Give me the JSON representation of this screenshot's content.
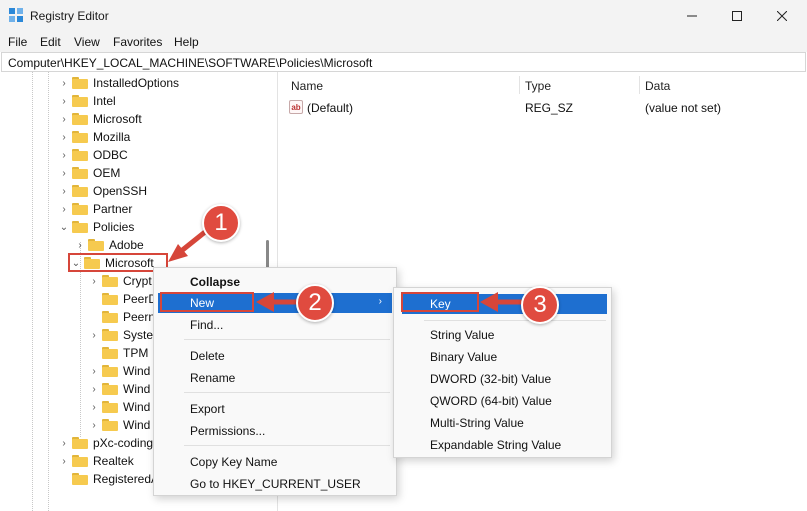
{
  "window": {
    "title": "Registry Editor"
  },
  "menu": [
    "File",
    "Edit",
    "View",
    "Favorites",
    "Help"
  ],
  "address": "Computer\\HKEY_LOCAL_MACHINE\\SOFTWARE\\Policies\\Microsoft",
  "tree": [
    {
      "label": "InstalledOptions",
      "expander": "›"
    },
    {
      "label": "Intel",
      "expander": "›"
    },
    {
      "label": "Microsoft",
      "expander": "›"
    },
    {
      "label": "Mozilla",
      "expander": "›"
    },
    {
      "label": "ODBC",
      "expander": "›"
    },
    {
      "label": "OEM",
      "expander": "›"
    },
    {
      "label": "OpenSSH",
      "expander": "›"
    },
    {
      "label": "Partner",
      "expander": "›"
    },
    {
      "label": "Policies",
      "expander": "⌄"
    },
    {
      "label": "Adobe",
      "expander": "›"
    },
    {
      "label": "Microsoft",
      "expander": "⌄"
    },
    {
      "label": "Crypt",
      "expander": "›"
    },
    {
      "label": "PeerD",
      "expander": ""
    },
    {
      "label": "Peern",
      "expander": ""
    },
    {
      "label": "Syster",
      "expander": "›"
    },
    {
      "label": "TPM",
      "expander": ""
    },
    {
      "label": "Wind",
      "expander": "›"
    },
    {
      "label": "Wind",
      "expander": "›"
    },
    {
      "label": "Wind",
      "expander": "›"
    },
    {
      "label": "Wind",
      "expander": "›"
    },
    {
      "label": "pXc-coding",
      "expander": "›"
    },
    {
      "label": "Realtek",
      "expander": "›"
    },
    {
      "label": "RegisteredA",
      "expander": ""
    }
  ],
  "values_table": {
    "headers": {
      "name": "Name",
      "type": "Type",
      "data": "Data"
    },
    "rows": [
      {
        "name": "(Default)",
        "type": "REG_SZ",
        "data": "(value not set)",
        "icon": "ab"
      }
    ]
  },
  "context_menu": [
    "Collapse",
    "New",
    "Find...",
    "Delete",
    "Rename",
    "Export",
    "Permissions...",
    "Copy Key Name",
    "Go to HKEY_CURRENT_USER"
  ],
  "submenu": [
    "Key",
    "String Value",
    "Binary Value",
    "DWORD (32-bit) Value",
    "QWORD (64-bit) Value",
    "Multi-String Value",
    "Expandable String Value"
  ],
  "callouts": [
    "1",
    "2",
    "3"
  ],
  "colors": {
    "highlight": "#1e6fd0",
    "callout": "#e04b3f",
    "folder": "#f6ca4f"
  },
  "icons": {
    "minimize": "minimize-icon",
    "maximize": "maximize-icon",
    "close": "close-icon",
    "submenu_arrow": "›"
  }
}
